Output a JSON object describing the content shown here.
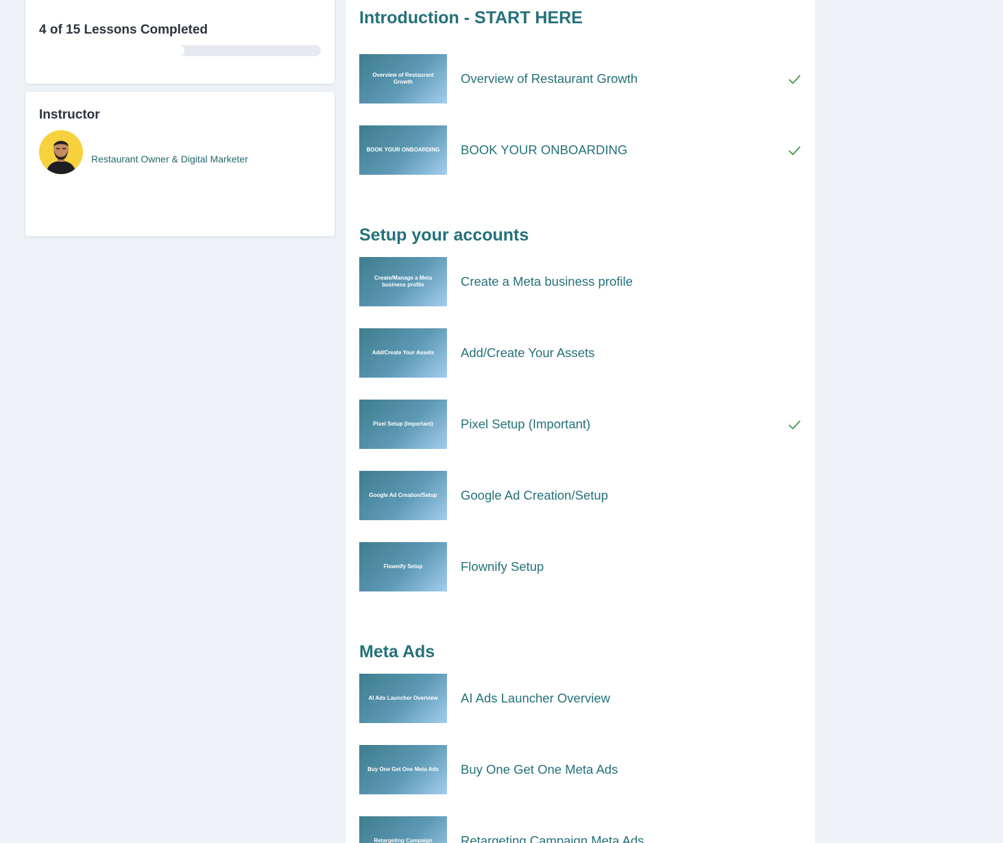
{
  "progress": {
    "title": "4 of 15 Lessons Completed",
    "completed": 4,
    "total": 15
  },
  "instructor": {
    "heading": "Instructor",
    "role": "Restaurant Owner & Digital Marketer",
    "avatar_icon": "person-avatar"
  },
  "colors": {
    "accent": "#24717a",
    "check": "#3f9a4b",
    "page_bg": "#eef2f6"
  },
  "sections": [
    {
      "title": "Introduction - START HERE",
      "lessons": [
        {
          "thumb": "Overview of Restaurant Growth",
          "title": "Overview of Restaurant Growth",
          "completed": true
        },
        {
          "thumb": "BOOK YOUR ONBOARDING",
          "title": "BOOK YOUR ONBOARDING",
          "completed": true
        }
      ]
    },
    {
      "title": "Setup your accounts",
      "lessons": [
        {
          "thumb": "Create/Manage a Meta business profile",
          "title": "Create a Meta business profile",
          "completed": false
        },
        {
          "thumb": "Add/Create Your Assets",
          "title": "Add/Create Your Assets",
          "completed": false
        },
        {
          "thumb": "Pixel Setup (Important)",
          "title": "Pixel Setup (Important)",
          "completed": true
        },
        {
          "thumb": "Google Ad Creation/Setup",
          "title": "Google Ad Creation/Setup",
          "completed": false
        },
        {
          "thumb": "Flownify Setup",
          "title": "Flownify Setup",
          "completed": false
        }
      ]
    },
    {
      "title": "Meta Ads",
      "lessons": [
        {
          "thumb": "AI Ads Launcher Overview",
          "title": "AI Ads Launcher Overview",
          "completed": false
        },
        {
          "thumb": "Buy One Get One Meta Ads",
          "title": "Buy One Get One Meta Ads",
          "completed": false
        },
        {
          "thumb": "Retargeting Campaign",
          "title": "Retargeting Campaign Meta Ads",
          "completed": false
        }
      ]
    }
  ]
}
